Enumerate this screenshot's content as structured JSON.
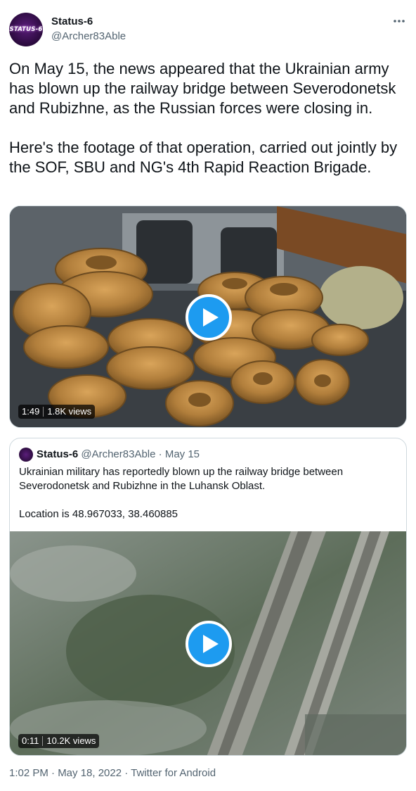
{
  "tweet": {
    "author": {
      "name": "Status-6",
      "handle": "@Archer83Able",
      "avatar_text": "STATUS-6"
    },
    "more_icon": "more-horizontal-icon",
    "text": "On May 15, the news appeared that the Ukrainian army has blown up the railway bridge between Severodonetsk and Rubizhne, as the Russian forces were closing in.\n\nHere's the footage of that operation, carried out jointly by the SOF, SBU and NG's 4th Rapid Reaction Brigade.",
    "video": {
      "duration": "1:49",
      "views": "1.8K views"
    },
    "quoted": {
      "name": "Status-6",
      "handle": "@Archer83Able",
      "separator": "·",
      "date": "May 15",
      "text": "Ukrainian military has reportedly blown up the railway bridge between Severodonetsk and Rubizhne in the Luhansk Oblast.\n\nLocation is 48.967033, 38.460885",
      "video": {
        "duration": "0:11",
        "views": "10.2K views"
      }
    },
    "footer": "1:02 PM · May 18, 2022 · Twitter for Android"
  },
  "colors": {
    "accent": "#1d9bf0",
    "text_primary": "#0f1419",
    "text_secondary": "#536471",
    "border": "#cfd9de"
  }
}
